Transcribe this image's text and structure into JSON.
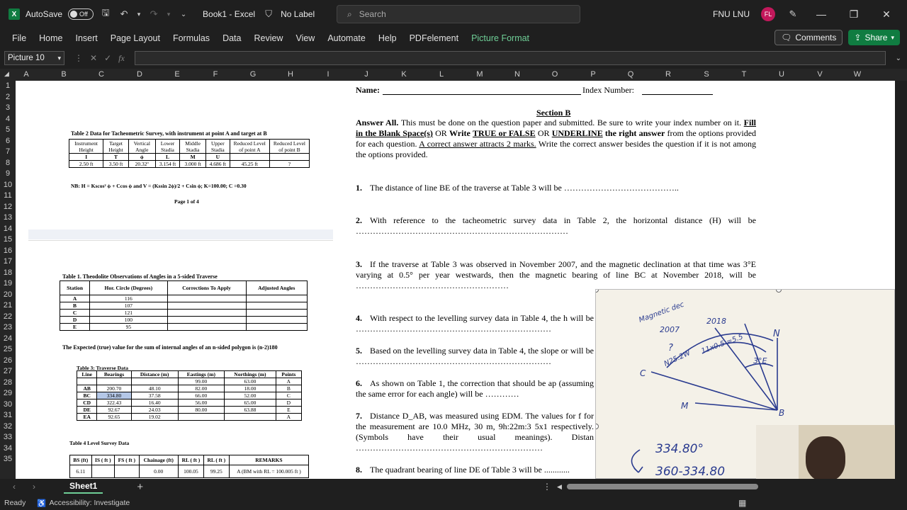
{
  "titlebar": {
    "autosave_label": "AutoSave",
    "autosave_state": "Off",
    "doc_title": "Book1  -  Excel",
    "label_text": "No Label",
    "search_placeholder": "Search",
    "user_name": "FNU LNU",
    "user_initials": "FL"
  },
  "menu": {
    "items": [
      "File",
      "Home",
      "Insert",
      "Page Layout",
      "Formulas",
      "Data",
      "Review",
      "View",
      "Automate",
      "Help",
      "PDFelement",
      "Picture Format"
    ],
    "comments": "Comments",
    "share": "Share"
  },
  "formula": {
    "namebox": "Picture 10",
    "fx": "fx"
  },
  "columns": [
    "A",
    "B",
    "C",
    "D",
    "E",
    "F",
    "G",
    "H",
    "I",
    "J",
    "K",
    "L",
    "M",
    "N",
    "O",
    "P",
    "Q",
    "R",
    "S",
    "T",
    "U",
    "V",
    "W"
  ],
  "rows": [
    "1",
    "2",
    "3",
    "4",
    "5",
    "6",
    "7",
    "8",
    "9",
    "10",
    "11",
    "12",
    "13",
    "14",
    "15",
    "16",
    "17",
    "18",
    "19",
    "20",
    "21",
    "22",
    "23",
    "24",
    "25",
    "26",
    "27",
    "28",
    "29",
    "30",
    "31",
    "32",
    "33",
    "34",
    "35"
  ],
  "left_doc": {
    "table2_title": "Table 2 Data for Tacheometric Survey, with instrument at point A and target at B",
    "table2_headers": [
      "Instrument Height",
      "Target Height",
      "Vertical Angle",
      "Lower Stadia",
      "Middle Stadia",
      "Upper Stadia",
      "Reduced Level of point A",
      "Reduced Level of point B"
    ],
    "table2_symbols": [
      "I",
      "T",
      "ϕ",
      "L",
      "M",
      "U",
      "",
      ""
    ],
    "table2_values": [
      "2.50 ft",
      "3.50 ft",
      "20.32º",
      "3.154 ft",
      "3.000 ft",
      "4.686 ft",
      "45.25 ft",
      "?"
    ],
    "table2_note": "NB: H = Kscos² ϕ + Ccos ϕ and V = (Kssin 2ϕ)/2 + Csin ϕ; K=100.00; C =0.30",
    "page_label": "Page 1 of 4",
    "table1_title": "Table 1. Theodolite Observations of Angles in a 5-sided Traverse",
    "table1_headers": [
      "Station",
      "Hor. Circle (Degrees)",
      "Corrections To Apply",
      "Adjusted Angles"
    ],
    "table1_rows": [
      [
        "A",
        "116"
      ],
      [
        "B",
        "107"
      ],
      [
        "C",
        "121"
      ],
      [
        "D",
        "100"
      ],
      [
        "E",
        "95"
      ]
    ],
    "table1_note": "The Expected (true) value for the sum of internal angles of an n-sided polygon is (n-2)180",
    "table3_title": "Table 3: Traverse Data",
    "table3_headers": [
      "Line",
      "Bearings",
      "Distance (m)",
      "Eastings (m)",
      "Northings (m)",
      "Points"
    ],
    "table3_rows": [
      [
        "",
        "",
        "",
        "99.00",
        "63.00",
        "A"
      ],
      [
        "AB",
        "200.70",
        "48.10",
        "82.00",
        "18.00",
        "B"
      ],
      [
        "BC",
        "334.80",
        "37.58",
        "66.00",
        "52.00",
        "C"
      ],
      [
        "CD",
        "322.43",
        "16.40",
        "56.00",
        "65.00",
        "D"
      ],
      [
        "DE",
        "92.67",
        "24.03",
        "80.00",
        "63.88",
        "E"
      ],
      [
        "EA",
        "92.65",
        "19.02",
        "",
        "",
        "A"
      ]
    ],
    "table4_title": "Table 4   Level Survey Data",
    "table4_headers": [
      "BS (ft)",
      "IS ( ft )",
      "FS ( ft )",
      "Chainage (ft)",
      "RL ( ft )",
      "RL ( ft )",
      "REMARKS"
    ],
    "table4_row": [
      "6.11",
      "",
      "",
      "0.00",
      "100.05",
      "99.25",
      "A (BM with RL = 100.005 ft )"
    ]
  },
  "right_doc": {
    "name_label": "Name:",
    "index_label": "Index Number:",
    "section": "Section B",
    "instructions_bold": "Answer All.",
    "instructions": "This must be done on the question paper and submitted. Be sure to write your index number on it.",
    "instr_fill": "Fill in the Blank Space(s)",
    "instr_or1": "OR",
    "instr_write": "Write",
    "instr_tf": "TRUE or FALSE",
    "instr_or2": "OR",
    "instr_underline": "UNDERLINE",
    "instr_right": "the right answer",
    "instructions2": "from the options provided for each question.",
    "instr_marks": "A correct answer attracts 2 marks.",
    "instructions3": "Write the correct answer besides the question if it is not among the options provided.",
    "questions": [
      {
        "n": "1.",
        "text": "The distance of line BE of the traverse at Table 3 will be  ………………………………….."
      },
      {
        "n": "2.",
        "text": "With reference to the tacheometric survey data in Table 2, the horizontal distance (H) will be …………………………………………………………………"
      },
      {
        "n": "3.",
        "text": "If the traverse at Table 3 was observed in November 2007, and the magnetic declination at that time was 3°E  varying at 0.5° per year westwards, then the magnetic bearing of line BC at November 2018, will be ………………………………………………"
      },
      {
        "n": "4.",
        "text": "With respect to the levelling survey data in Table 4, the h will be ……………………………………………………………"
      },
      {
        "n": "5.",
        "text": "Based on the levelling survey data in Table 4, the slope or will be ……………………………………………………………"
      },
      {
        "n": "6.",
        "text": "As shown on Table 1, the correction that should be ap (assuming the same error for each angle) will be …………"
      },
      {
        "n": "7.",
        "text": "Distance D_AB, was measured using EDM. The values for f for the measurement are 10.0 MHz, 30 m, 9h:22m:3 5x1 respectively. (Symbols have their usual meanings). Distan …………………………………………………………"
      },
      {
        "n": "8.",
        "text": "The quadrant bearing of line DE of Table 3 will be ............"
      }
    ]
  },
  "photo": {
    "note_magnetic": "Magnetic dec",
    "note_2007": "2007",
    "note_2018": "2018",
    "note_q": "?",
    "note_n": "N",
    "note_bearing": "N25.2W",
    "note_calc": "11x0.5 =5.5",
    "note_3e": "3°E",
    "note_c": "C",
    "note_m": "M",
    "note_b": "B",
    "note_334": "334.80°",
    "note_360": "360-334.80"
  },
  "sheet": {
    "tab": "Sheet1"
  },
  "status": {
    "ready": "Ready",
    "accessibility": "Accessibility: Investigate"
  }
}
